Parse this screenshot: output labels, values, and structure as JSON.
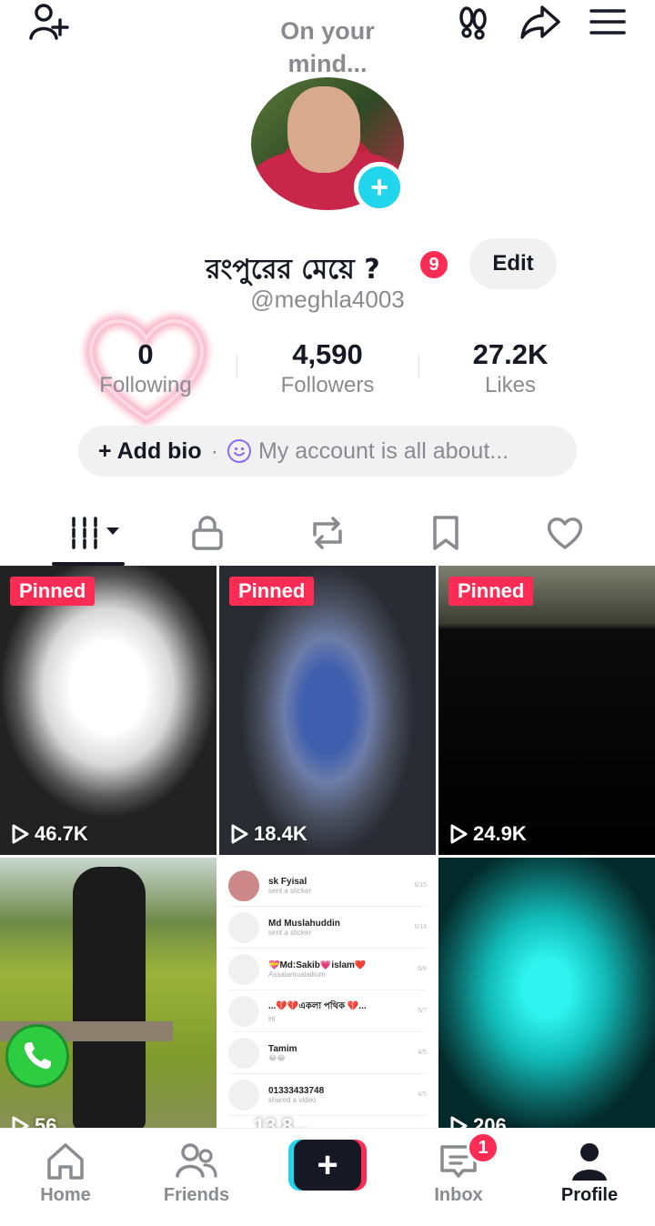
{
  "header": {
    "status_prompt": "On your mind...",
    "icons": [
      "add-user-icon",
      "footprints-icon",
      "share-icon",
      "menu-icon"
    ]
  },
  "profile": {
    "display_name": "রংপুরের মেয়ে ?",
    "notification_count": "9",
    "edit_label": "Edit",
    "handle": "@meghla4003"
  },
  "stats": [
    {
      "value": "0",
      "label": "Following"
    },
    {
      "value": "4,590",
      "label": "Followers"
    },
    {
      "value": "27.2K",
      "label": "Likes"
    }
  ],
  "bio": {
    "add_label": "+ Add bio",
    "separator": "·",
    "placeholder": "My account is all about..."
  },
  "tabs": [
    "videos-grid-icon",
    "lock-icon",
    "repost-icon",
    "bookmark-icon",
    "heart-icon"
  ],
  "videos": [
    {
      "pinned_label": "Pinned",
      "views": "46.7K"
    },
    {
      "pinned_label": "Pinned",
      "views": "18.4K"
    },
    {
      "pinned_label": "Pinned",
      "views": "24.9K"
    },
    {
      "views": "56..."
    },
    {
      "views": "13.8..."
    },
    {
      "views": "206..."
    }
  ],
  "chat_thumbnail": [
    {
      "name": "sk Fyisal",
      "msg": "sent a sticker",
      "date": "6/15"
    },
    {
      "name": "Md Muslahuddin",
      "msg": "sent a sticker",
      "date": "6/14"
    },
    {
      "name": "💝Md:Sakib💗islam❤️",
      "msg": "Assalamualaikum",
      "date": "6/8"
    },
    {
      "name": "...💔💔একলা পথিক 💔...",
      "msg": "Hi",
      "date": "5/7"
    },
    {
      "name": "Tamim",
      "msg": "😂😂",
      "date": "4/5"
    },
    {
      "name": "01333433748",
      "msg": "shared a video",
      "date": "4/5"
    }
  ],
  "nav": {
    "home": "Home",
    "friends": "Friends",
    "create": "+",
    "inbox": "Inbox",
    "inbox_badge": "1",
    "profile": "Profile"
  },
  "colors": {
    "accent_red": "#fe2c55",
    "accent_cyan": "#20d5ec",
    "text_primary": "#161823",
    "text_secondary": "#8a8b91"
  }
}
